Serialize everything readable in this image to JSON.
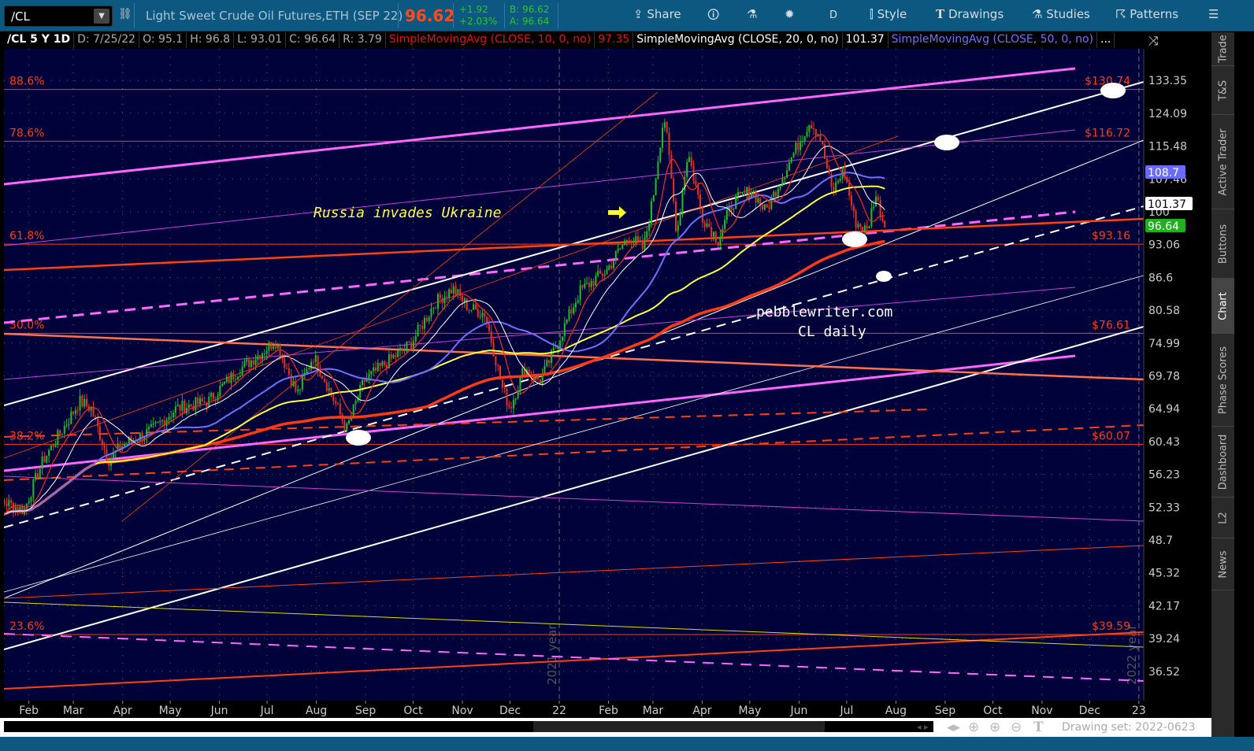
{
  "header": {
    "symbol": "/CL",
    "description": "Light Sweet Crude Oil Futures,ETH (SEP 22)",
    "last": "96.62",
    "change": "+1.92",
    "change_pct": "+2.03%",
    "bid": "B: 96.62",
    "ask": "A: 96.64",
    "toolbar": {
      "share": "Share",
      "period": "D",
      "style": "Style",
      "drawings": "Drawings",
      "studies": "Studies",
      "patterns": "Patterns"
    }
  },
  "infobar": {
    "title": "/CL 5 Y 1D",
    "date": "D: 7/25/22",
    "open": "O: 95.1",
    "high": "H: 96.8",
    "low": "L: 93.01",
    "close": "C: 96.64",
    "range": "R: 3.79",
    "sma10": "SimpleMovingAvg (CLOSE, 10, 0, no)",
    "sma10_val": "97.35",
    "sma20": "SimpleMovingAvg (CLOSE, 20, 0, no)",
    "sma20_val": "101.37",
    "sma50": "SimpleMovingAvg (CLOSE, 50, 0, no)",
    "more": "..."
  },
  "side_tabs": [
    "Trade",
    "T&S",
    "Active Trader",
    "Buttons",
    "Chart",
    "Phase Scores",
    "Dashboard",
    "L2",
    "News"
  ],
  "bottom": {
    "drawing_set": "Drawing set: 2022-0623"
  },
  "colors": {
    "background": "#02023a",
    "up": "#1fbf1f",
    "down": "#e8331a",
    "sma10": "#ff2a1a",
    "sma20": "#ffffff",
    "sma50": "#7070ff",
    "sma100": "#ffff33",
    "sma200": "#ff3a10",
    "fib": "#ff3a10"
  },
  "chart_data": {
    "type": "candlestick",
    "yscale": "log",
    "ylim": [
      35,
      138
    ],
    "xlim": [
      "2021-01-16",
      "2023-01-05"
    ],
    "y_ticks": [
      "133.35",
      "124.09",
      "115.48",
      "107.46",
      "100",
      "93.06",
      "86.6",
      "80.58",
      "74.99",
      "69.78",
      "64.94",
      "60.43",
      "56.23",
      "52.33",
      "48.7",
      "45.32",
      "42.17",
      "39.24",
      "36.52"
    ],
    "x_ticks": [
      {
        "label": "Feb",
        "date": "2021-02-01"
      },
      {
        "label": "Mar",
        "date": "2021-03-01"
      },
      {
        "label": "Apr",
        "date": "2021-04-01"
      },
      {
        "label": "May",
        "date": "2021-05-01"
      },
      {
        "label": "Jun",
        "date": "2021-06-01"
      },
      {
        "label": "Jul",
        "date": "2021-07-01"
      },
      {
        "label": "Aug",
        "date": "2021-08-01"
      },
      {
        "label": "Sep",
        "date": "2021-09-01"
      },
      {
        "label": "Oct",
        "date": "2021-10-01"
      },
      {
        "label": "Nov",
        "date": "2021-11-01"
      },
      {
        "label": "Dec",
        "date": "2021-12-01"
      },
      {
        "label": "22",
        "date": "2022-01-01"
      },
      {
        "label": "Feb",
        "date": "2022-02-01"
      },
      {
        "label": "Mar",
        "date": "2022-03-01"
      },
      {
        "label": "Apr",
        "date": "2022-04-01"
      },
      {
        "label": "May",
        "date": "2022-05-01"
      },
      {
        "label": "Jun",
        "date": "2022-06-01"
      },
      {
        "label": "Jul",
        "date": "2022-07-01"
      },
      {
        "label": "Aug",
        "date": "2022-08-01"
      },
      {
        "label": "Sep",
        "date": "2022-09-01"
      },
      {
        "label": "Oct",
        "date": "2022-10-01"
      },
      {
        "label": "Nov",
        "date": "2022-11-01"
      },
      {
        "label": "Dec",
        "date": "2022-12-01"
      },
      {
        "label": "23",
        "date": "2023-01-01"
      }
    ],
    "year_labels": [
      {
        "label": "2021 year",
        "date": "2022-01-01"
      },
      {
        "label": "2022 year",
        "date": "2023-01-01"
      }
    ],
    "fib_levels": [
      {
        "pct": "88.6%",
        "price": "$130.74",
        "value": 130.74
      },
      {
        "pct": "78.6%",
        "price": "$116.72",
        "value": 116.72
      },
      {
        "pct": "61.8%",
        "price": "$93.16",
        "value": 93.16
      },
      {
        "pct": "50.0%",
        "price": "$76.61",
        "value": 76.61
      },
      {
        "pct": "38.2%",
        "price": "$60.07",
        "value": 60.07
      },
      {
        "pct": "23.6%",
        "price": "$39.59",
        "value": 39.59
      }
    ],
    "price_badges": [
      {
        "label": "108.7",
        "color": "#6a6aff"
      },
      {
        "label": "101.37",
        "color": "#ffffff"
      },
      {
        "label": "96.64",
        "color": "#1faf1f"
      }
    ],
    "annotations": [
      "Russia invades Ukraine",
      "pebblewriter.com",
      "CL daily"
    ],
    "approx_close_path": [
      [
        "2021-01-04",
        50
      ],
      [
        "2021-01-15",
        53
      ],
      [
        "2021-01-29",
        52
      ],
      [
        "2021-02-10",
        58
      ],
      [
        "2021-02-25",
        63
      ],
      [
        "2021-03-05",
        66
      ],
      [
        "2021-03-12",
        65
      ],
      [
        "2021-03-23",
        58
      ],
      [
        "2021-04-01",
        60
      ],
      [
        "2021-04-20",
        62
      ],
      [
        "2021-05-05",
        65
      ],
      [
        "2021-05-25",
        66
      ],
      [
        "2021-06-10",
        70
      ],
      [
        "2021-06-30",
        74
      ],
      [
        "2021-07-06",
        75.5
      ],
      [
        "2021-07-20",
        67
      ],
      [
        "2021-07-30",
        73
      ],
      [
        "2021-08-20",
        62
      ],
      [
        "2021-08-31",
        69
      ],
      [
        "2021-09-15",
        72
      ],
      [
        "2021-09-30",
        75
      ],
      [
        "2021-10-15",
        82
      ],
      [
        "2021-10-26",
        84.5
      ],
      [
        "2021-11-05",
        81
      ],
      [
        "2021-11-15",
        80
      ],
      [
        "2021-11-26",
        68
      ],
      [
        "2021-12-01",
        65
      ],
      [
        "2021-12-10",
        71
      ],
      [
        "2021-12-20",
        69
      ],
      [
        "2021-12-31",
        75
      ],
      [
        "2022-01-14",
        84
      ],
      [
        "2022-01-31",
        88
      ],
      [
        "2022-02-14",
        95
      ],
      [
        "2022-02-23",
        92
      ],
      [
        "2022-03-01",
        103
      ],
      [
        "2022-03-08",
        123.7
      ],
      [
        "2022-03-16",
        95
      ],
      [
        "2022-03-23",
        114
      ],
      [
        "2022-04-01",
        99
      ],
      [
        "2022-04-11",
        94
      ],
      [
        "2022-04-20",
        102
      ],
      [
        "2022-05-02",
        105
      ],
      [
        "2022-05-11",
        100
      ],
      [
        "2022-05-24",
        110
      ],
      [
        "2022-06-08",
        122
      ],
      [
        "2022-06-14",
        118
      ],
      [
        "2022-06-22",
        104
      ],
      [
        "2022-06-29",
        110
      ],
      [
        "2022-07-06",
        98
      ],
      [
        "2022-07-14",
        95.8
      ],
      [
        "2022-07-19",
        104
      ],
      [
        "2022-07-25",
        96.64
      ]
    ]
  }
}
